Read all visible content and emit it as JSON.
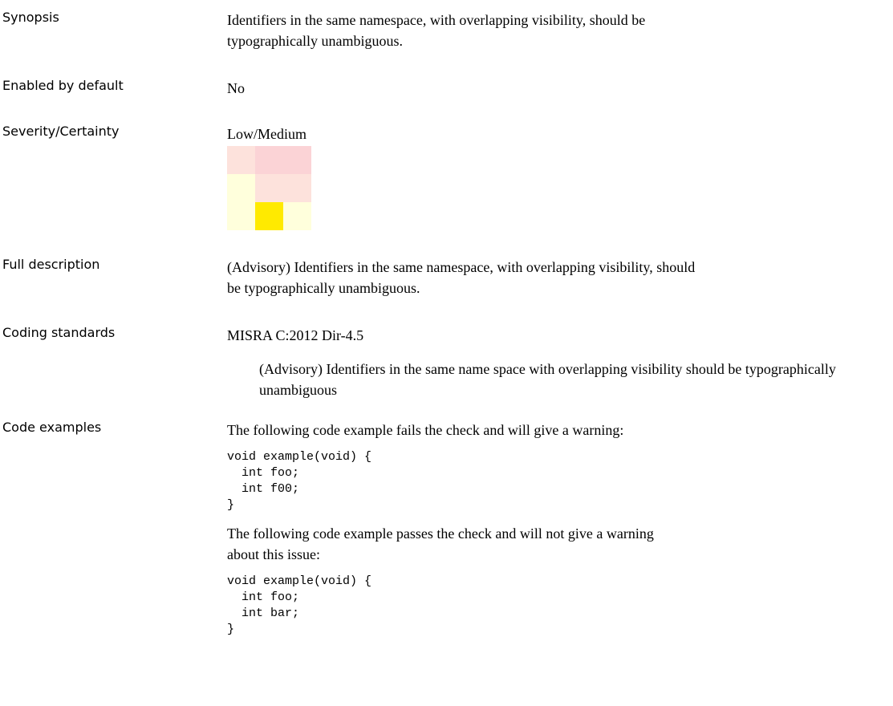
{
  "synopsis": {
    "label": "Synopsis",
    "text": "Identifiers in the same namespace, with overlapping visibility, should be typographically unambiguous."
  },
  "enabled_by_default": {
    "label": "Enabled by default",
    "value": "No"
  },
  "severity_certainty": {
    "label": "Severity/Certainty",
    "value": "Low/Medium",
    "matrix": {
      "colors": [
        [
          "#fde2dc",
          "#fbd3d6",
          "#fbd3d6"
        ],
        [
          "#ffffdc",
          "#fde2dc",
          "#fde2dc"
        ],
        [
          "#ffffdc",
          "#ffea00",
          "#ffffdc"
        ]
      ]
    }
  },
  "full_description": {
    "label": "Full description",
    "text": "(Advisory) Identifiers in the same namespace, with overlapping visibility, should be typographically unambiguous."
  },
  "coding_standards": {
    "label": "Coding standards",
    "standard": "MISRA C:2012 Dir-4.5",
    "description": "(Advisory) Identifiers in the same name space with overlapping visibility should be typographically unambiguous"
  },
  "code_examples": {
    "label": "Code examples",
    "fail_intro": "The following code example fails the check and will give a warning:",
    "fail_code": "void example(void) {\n  int foo;\n  int f00;\n}",
    "pass_intro": "The following code example passes the check and will not give a warning about this issue:",
    "pass_code": "void example(void) {\n  int foo;\n  int bar;\n}"
  }
}
